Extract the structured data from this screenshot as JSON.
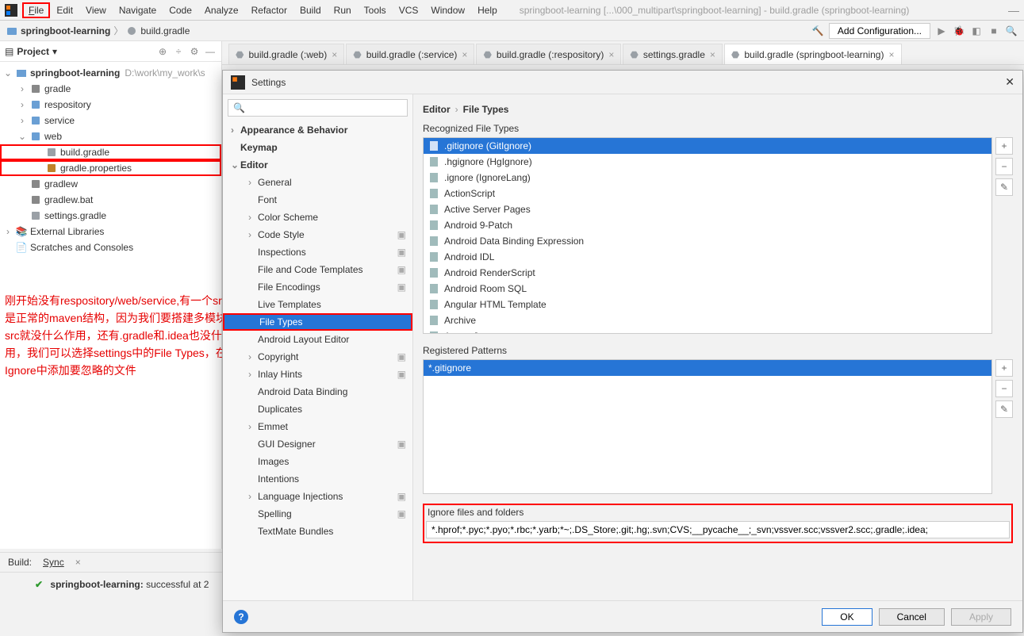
{
  "window": {
    "title_path": "springboot-learning [...\\000_multipart\\springboot-learning] - build.gradle (springboot-learning)"
  },
  "menu": [
    "File",
    "Edit",
    "View",
    "Navigate",
    "Code",
    "Analyze",
    "Refactor",
    "Build",
    "Run",
    "Tools",
    "VCS",
    "Window",
    "Help"
  ],
  "breadcrumb": {
    "project": "springboot-learning",
    "file": "build.gradle"
  },
  "toolbar": {
    "add_config": "Add Configuration..."
  },
  "project_panel": {
    "title": "Project",
    "root": "springboot-learning",
    "root_path": "D:\\work\\my_work\\s",
    "items": [
      {
        "label": "gradle",
        "indent": 1,
        "type": "folder"
      },
      {
        "label": "respository",
        "indent": 1,
        "type": "module"
      },
      {
        "label": "service",
        "indent": 1,
        "type": "module"
      },
      {
        "label": "web",
        "indent": 1,
        "type": "module",
        "expanded": true
      },
      {
        "label": "build.gradle",
        "indent": 2,
        "type": "gradle",
        "boxed": true
      },
      {
        "label": "gradle.properties",
        "indent": 2,
        "type": "props",
        "boxed": true
      },
      {
        "label": "gradlew",
        "indent": 1,
        "type": "sh"
      },
      {
        "label": "gradlew.bat",
        "indent": 1,
        "type": "bat"
      },
      {
        "label": "settings.gradle",
        "indent": 1,
        "type": "gradle"
      }
    ],
    "ext_lib": "External Libraries",
    "scratches": "Scratches and Consoles"
  },
  "editor_tabs": [
    {
      "label": "build.gradle (:web)",
      "active": false
    },
    {
      "label": "build.gradle (:service)",
      "active": false
    },
    {
      "label": "build.gradle (:respository)",
      "active": false
    },
    {
      "label": "settings.gradle",
      "active": false
    },
    {
      "label": "build.gradle (springboot-learning)",
      "active": true
    }
  ],
  "annotation": "刚开始没有respository/web/service,有一个src，\n是正常的maven结构，因为我们要搭建多模块，src就没什么作用，还有.gradle和.idea也没什么用，我们可以选择settings中的File Types，在Ignore中添加要忽略的文件",
  "build_bar": {
    "label": "Build:",
    "tab": "Sync"
  },
  "sync_result": {
    "project": "springboot-learning:",
    "status": "successful at 2"
  },
  "settings": {
    "title": "Settings",
    "search_placeholder": "",
    "tree": [
      {
        "label": "Appearance & Behavior",
        "l": 1,
        "arr": "›"
      },
      {
        "label": "Keymap",
        "l": 1,
        "arr": ""
      },
      {
        "label": "Editor",
        "l": 1,
        "arr": "⌄"
      },
      {
        "label": "General",
        "l": 2,
        "arr": "›"
      },
      {
        "label": "Font",
        "l": 2,
        "arr": ""
      },
      {
        "label": "Color Scheme",
        "l": 2,
        "arr": "›"
      },
      {
        "label": "Code Style",
        "l": 2,
        "arr": "›",
        "sico": true
      },
      {
        "label": "Inspections",
        "l": 2,
        "arr": "",
        "sico": true
      },
      {
        "label": "File and Code Templates",
        "l": 2,
        "arr": "",
        "sico": true
      },
      {
        "label": "File Encodings",
        "l": 2,
        "arr": "",
        "sico": true
      },
      {
        "label": "Live Templates",
        "l": 2,
        "arr": "",
        "boxtop": true
      },
      {
        "label": "File Types",
        "l": 2,
        "arr": "",
        "selected": true,
        "boxed": true
      },
      {
        "label": "Android Layout Editor",
        "l": 2,
        "arr": ""
      },
      {
        "label": "Copyright",
        "l": 2,
        "arr": "›",
        "sico": true
      },
      {
        "label": "Inlay Hints",
        "l": 2,
        "arr": "›",
        "sico": true
      },
      {
        "label": "Android Data Binding",
        "l": 2,
        "arr": ""
      },
      {
        "label": "Duplicates",
        "l": 2,
        "arr": ""
      },
      {
        "label": "Emmet",
        "l": 2,
        "arr": "›"
      },
      {
        "label": "GUI Designer",
        "l": 2,
        "arr": "",
        "sico": true
      },
      {
        "label": "Images",
        "l": 2,
        "arr": ""
      },
      {
        "label": "Intentions",
        "l": 2,
        "arr": ""
      },
      {
        "label": "Language Injections",
        "l": 2,
        "arr": "›",
        "sico": true
      },
      {
        "label": "Spelling",
        "l": 2,
        "arr": "",
        "sico": true
      },
      {
        "label": "TextMate Bundles",
        "l": 2,
        "arr": ""
      }
    ],
    "crumb": [
      "Editor",
      "File Types"
    ],
    "recognized_label": "Recognized File Types",
    "file_types": [
      {
        "label": ".gitignore (GitIgnore)",
        "selected": true
      },
      {
        "label": ".hgignore (HgIgnore)"
      },
      {
        "label": ".ignore (IgnoreLang)"
      },
      {
        "label": "ActionScript"
      },
      {
        "label": "Active Server Pages"
      },
      {
        "label": "Android 9-Patch"
      },
      {
        "label": "Android Data Binding Expression"
      },
      {
        "label": "Android IDL"
      },
      {
        "label": "Android RenderScript"
      },
      {
        "label": "Android Room SQL"
      },
      {
        "label": "Angular HTML Template"
      },
      {
        "label": "Archive"
      },
      {
        "label": "AspectJ"
      }
    ],
    "patterns_label": "Registered Patterns",
    "patterns": [
      {
        "label": "*.gitignore",
        "selected": true
      }
    ],
    "ignore_label": "Ignore files and folders",
    "ignore_value": "*.hprof;*.pyc;*.pyo;*.rbc;*.yarb;*~;.DS_Store;.git;.hg;.svn;CVS;__pycache__;_svn;vssver.scc;vssver2.scc;.gradle;.idea;",
    "buttons": {
      "ok": "OK",
      "cancel": "Cancel",
      "apply": "Apply"
    }
  }
}
